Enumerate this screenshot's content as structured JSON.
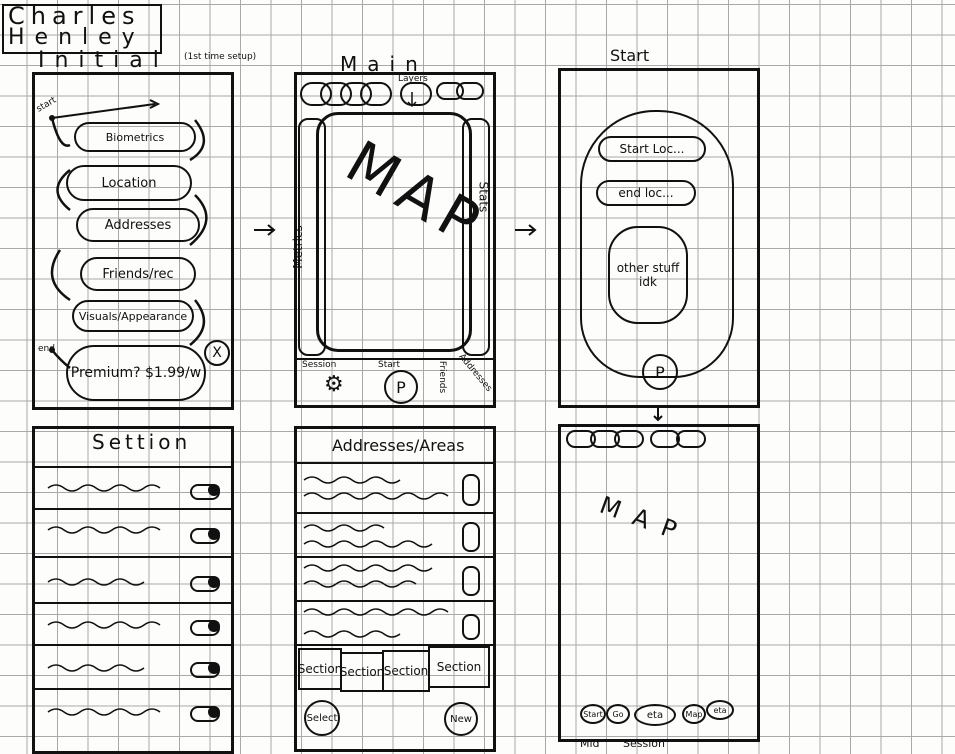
{
  "author": {
    "first": "Charles",
    "last": "Henley"
  },
  "initial": {
    "title": "Initial",
    "note": "(1st time setup)",
    "start_label": "start",
    "end_label": "end",
    "steps": [
      "Biometrics",
      "Location",
      "Addresses",
      "Friends/rec",
      "Visuals/Appearance"
    ],
    "premium": "Premium? $1.99/w",
    "close": "X"
  },
  "main": {
    "title": "Main",
    "layers_label": "Layers",
    "map_text": "MAP",
    "left_panel": "Metrics",
    "right_panel": "Stats",
    "bottom": [
      "Session",
      "Start",
      "Friends",
      "Addresses"
    ],
    "start_icon": "P"
  },
  "start": {
    "title": "Start",
    "start_loc": "Start Loc...",
    "end_loc": "end loc...",
    "other": "other stuff idk",
    "go_icon": "P"
  },
  "settings": {
    "title": "Settion",
    "rows": 6
  },
  "addresses": {
    "title": "Addresses/Areas",
    "tabs": [
      "Section",
      "Section",
      "Section",
      "Section"
    ],
    "btn_left": "Select",
    "btn_right": "New"
  },
  "session": {
    "map_text": "MAP",
    "footer": "Mid Session",
    "buttons": [
      "Start",
      "Go",
      "eta",
      "Map",
      "eta"
    ]
  }
}
